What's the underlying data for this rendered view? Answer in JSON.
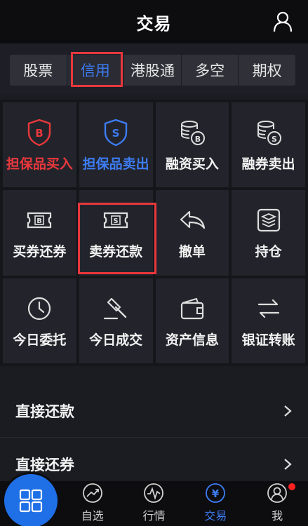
{
  "header": {
    "title": "交易"
  },
  "tabs": [
    {
      "label": "股票"
    },
    {
      "label": "信用"
    },
    {
      "label": "港股通"
    },
    {
      "label": "多空"
    },
    {
      "label": "期权"
    }
  ],
  "grid": [
    {
      "label": "担保品买入",
      "icon": "shield-b-icon"
    },
    {
      "label": "担保品卖出",
      "icon": "shield-s-icon"
    },
    {
      "label": "融资买入",
      "icon": "coins-b-icon"
    },
    {
      "label": "融券卖出",
      "icon": "coins-s-icon"
    },
    {
      "label": "买券还券",
      "icon": "ticket-b-icon"
    },
    {
      "label": "卖券还款",
      "icon": "ticket-s-icon"
    },
    {
      "label": "撤单",
      "icon": "undo-icon"
    },
    {
      "label": "持仓",
      "icon": "layers-icon"
    },
    {
      "label": "今日委托",
      "icon": "clock-icon"
    },
    {
      "label": "今日成交",
      "icon": "gavel-icon"
    },
    {
      "label": "资产信息",
      "icon": "wallet-icon"
    },
    {
      "label": "银证转账",
      "icon": "transfer-icon"
    }
  ],
  "list": [
    {
      "label": "直接还款"
    },
    {
      "label": "直接还券"
    }
  ],
  "bottom_nav": [
    {
      "label": "自选",
      "icon": "trend-icon"
    },
    {
      "label": "行情",
      "icon": "pulse-icon"
    },
    {
      "label": "交易",
      "icon": "yen-icon"
    },
    {
      "label": "我",
      "icon": "profile-icon"
    }
  ],
  "colors": {
    "accent": "#3d7cf4",
    "highlight": "#e8383d",
    "home_button": "#1f6fe6"
  }
}
